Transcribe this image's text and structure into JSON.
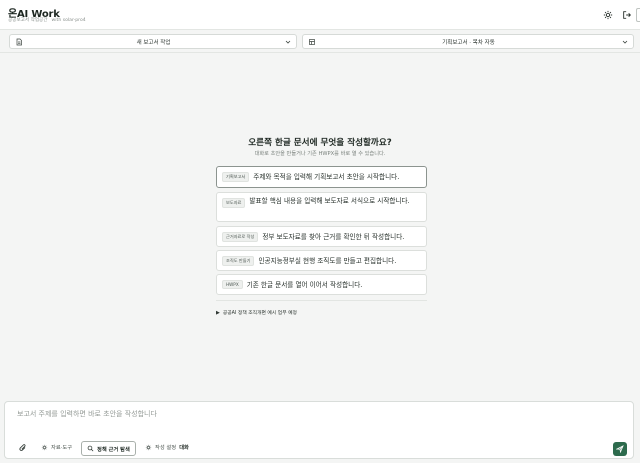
{
  "header": {
    "title": "온AI Work",
    "subtitle": "공공보고서 작업공간",
    "model": "with solar-pro4",
    "icons": [
      "settings-icon",
      "logout-icon"
    ]
  },
  "selectors": {
    "report": {
      "label": "새 보고서 작업",
      "icon": "document-icon"
    },
    "template": {
      "label": "기획보고서 · 목차 자동",
      "icon": "template-icon"
    }
  },
  "main": {
    "heading": "오른쪽 한글 문서에 무엇을 작성할까요?",
    "subheading": "대화로 초안을 만들거나 기존 HWPX를 바로 열 수 있습니다.",
    "suggestions": [
      {
        "tag": "기획보고서",
        "text": "주제와 목적을 입력해 기획보고서 초안을 시작합니다."
      },
      {
        "tag": "보도자료",
        "text": "발표할 핵심 내용을 입력해 보도자료 서식으로 시작합니다."
      },
      {
        "tag": "근거자료로 작성",
        "text": "정부 보도자료를 찾아 근거를 확인한 뒤 작성합니다."
      },
      {
        "tag": "조직도 만들기",
        "text": "인공지능정부실 현행 조직도를 만들고 편집합니다."
      },
      {
        "tag": "HWPX",
        "text": "기존 한글 문서를 열어 이어서 작성합니다."
      }
    ],
    "example_toggle": "공공AI 정책 조직개편 예시 업무 예정"
  },
  "composer": {
    "placeholder": "보고서 주제를 입력하면 바로 초안을 작성합니다",
    "tools": {
      "materials_label": "자료·도구",
      "policy_search_label": "정책 근거 탐색",
      "settings_label": "작성 설정",
      "settings_value": "대화"
    }
  },
  "colors": {
    "accent": "#2d6b4d",
    "background": "#f4f5f4"
  }
}
